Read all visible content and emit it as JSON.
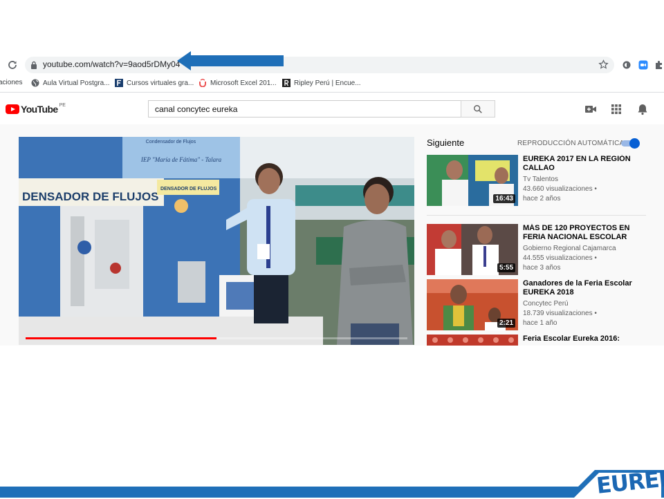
{
  "browser": {
    "url": "youtube.com/watch?v=9aod5rDMy04",
    "bookmarks": [
      {
        "label": "aciones",
        "icon": "apps-icon"
      },
      {
        "label": "Aula Virtual Postgra...",
        "icon": "globe-icon"
      },
      {
        "label": "Cursos virtuales gra...",
        "icon": "f-square-icon"
      },
      {
        "label": "Microsoft Excel 201...",
        "icon": "udemy-icon"
      },
      {
        "label": "Ripley Perú | Encue...",
        "icon": "r-square-icon"
      }
    ]
  },
  "youtube": {
    "logo_text": "YouTube",
    "country_code": "PE",
    "search_query": "canal concytec eureka",
    "up_next_label": "Siguiente",
    "autoplay_label": "REPRODUCCIÓN AUTOMÁTICA",
    "autoplay_on": true,
    "player_progress_fraction": 0.5,
    "recommendations": [
      {
        "title": "EUREKA 2017 EN LA REGIÓN CALLAO",
        "channel": "Tv Talentos",
        "views": "43.660 visualizaciones •",
        "age": "hace 2 años",
        "duration": "16:43"
      },
      {
        "title": "MÁS DE 120 PROYECTOS EN FERIA NACIONAL ESCOLAR D...",
        "channel": "Gobierno Regional Cajamarca",
        "views": "44.555 visualizaciones •",
        "age": "hace 3 años",
        "duration": "5:55"
      },
      {
        "title": "Ganadores de la Feria Escolar EUREKA 2018",
        "channel": "Concytec Perú",
        "views": "18.739 visualizaciones •",
        "age": "hace 1 año",
        "duration": "2:21"
      },
      {
        "title": "Feria Escolar Eureka 2016:",
        "channel": "",
        "views": "",
        "age": "",
        "duration": ""
      }
    ]
  },
  "video_scene": {
    "banner_text": "DENSADOR DE FLUJOS",
    "sub_banner_text": "IEP \"María de Fátima\" - Talara",
    "small_label": "Condensador de Flujos",
    "sign_text": "DENSADOR DE FLUJOS"
  },
  "slide": {
    "logo_text": "EUREKA!",
    "colors": {
      "accent_blue": "#1f6fb8",
      "arrow_blue": "#1f6fb8",
      "yt_red": "#ff0000"
    }
  }
}
